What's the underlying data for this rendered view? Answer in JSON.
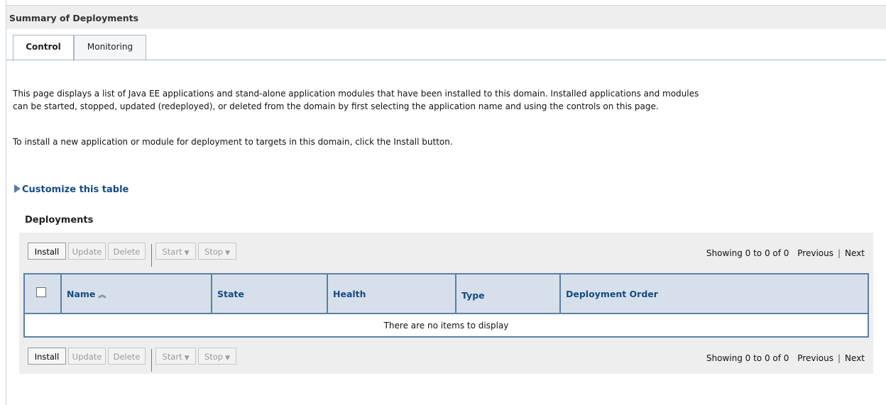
{
  "header": {
    "title": "Summary of Deployments"
  },
  "tabs": [
    {
      "label": "Control",
      "active": true
    },
    {
      "label": "Monitoring",
      "active": false
    }
  ],
  "description": {
    "line1": "This page displays a list of Java EE applications and stand-alone application modules that have been installed to this domain. Installed applications and modules",
    "line2": "can be started, stopped, updated (redeployed), or deleted from the domain by first selecting the application name and using the controls on this page.",
    "line3": "To install a new application or module for deployment to targets in this domain, click the Install button."
  },
  "customize_link": "Customize this table",
  "section_title": "Deployments",
  "toolbar": {
    "install": "Install",
    "update": "Update",
    "delete": "Delete",
    "start": "Start",
    "stop": "Stop"
  },
  "pager": {
    "showing": "Showing 0 to 0 of 0",
    "previous": "Previous",
    "divider": "|",
    "next": "Next"
  },
  "table": {
    "columns": [
      "Name",
      "State",
      "Health",
      "Type",
      "Deployment Order"
    ],
    "empty_message": "There are no items to display"
  },
  "colors": {
    "link": "#154b84",
    "grid_border": "#5b7fa8",
    "header_bg": "#d7e0ea",
    "panel_bg": "#eeeeee"
  }
}
